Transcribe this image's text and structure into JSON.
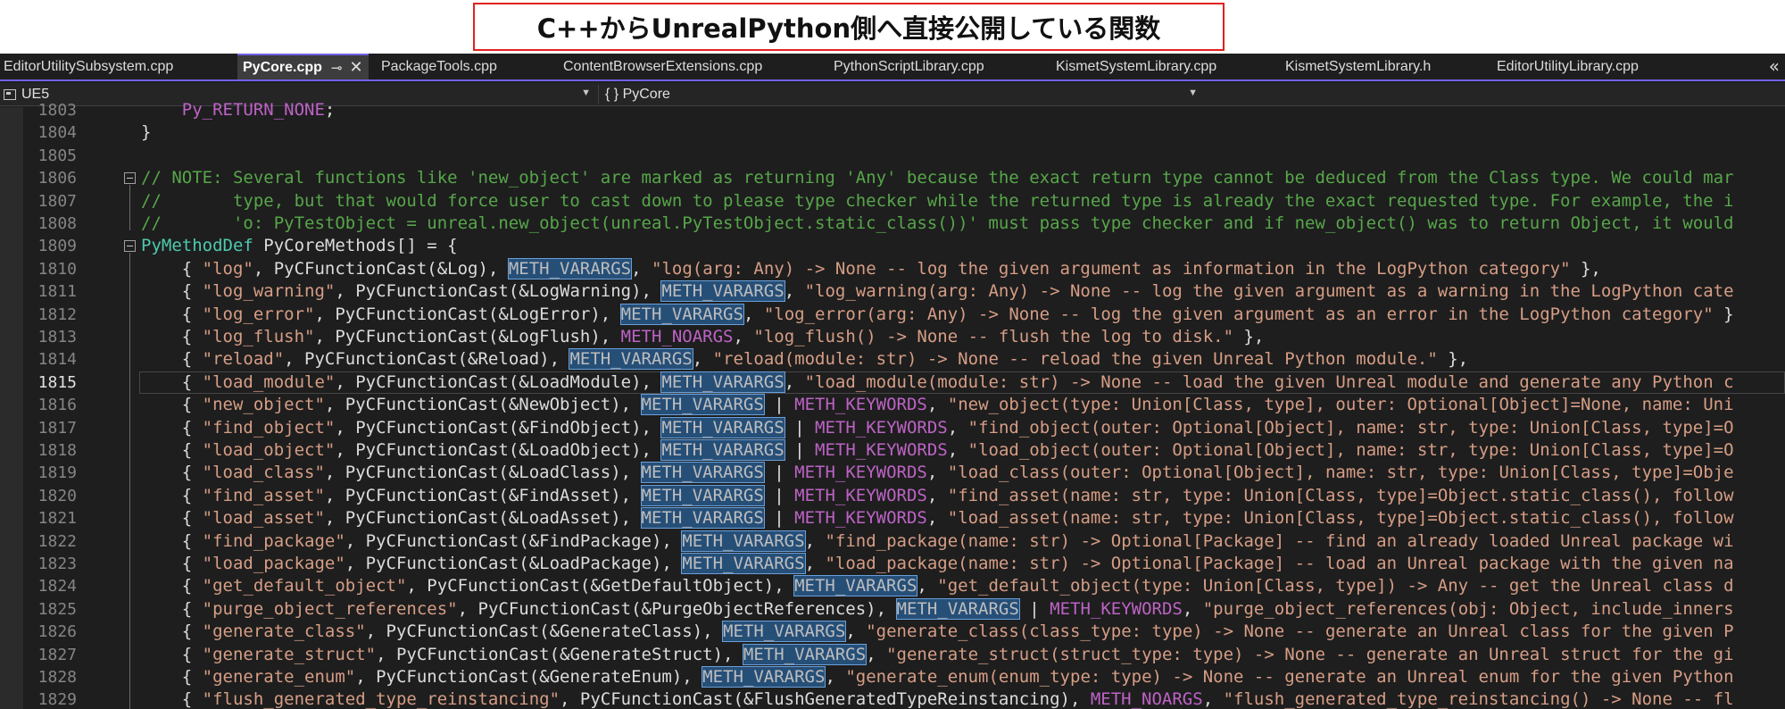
{
  "banner": {
    "title": "C++からUnrealPython側へ直接公開している関数"
  },
  "tabs": [
    {
      "label": "EditorUtilitySubsystem.cpp",
      "active": false
    },
    {
      "label": "PyCore.cpp",
      "active": true
    },
    {
      "label": "PackageTools.cpp",
      "active": false
    },
    {
      "label": "ContentBrowserExtensions.cpp",
      "active": false
    },
    {
      "label": "PythonScriptLibrary.cpp",
      "active": false
    },
    {
      "label": "KismetSystemLibrary.cpp",
      "active": false
    },
    {
      "label": "KismetSystemLibrary.h",
      "active": false
    },
    {
      "label": "EditorUtilityLibrary.cpp",
      "active": false
    }
  ],
  "tab_icons": {
    "pin": "pin-icon",
    "close": "close-icon",
    "overflow": "chevron-double-left-icon"
  },
  "navbar": {
    "project": "UE5",
    "scope": "{ } PyCore"
  },
  "current_line": "1815",
  "lines": [
    {
      "n": "1803",
      "code": "    Py_RETURN_NONE;"
    },
    {
      "n": "1804",
      "code": "}"
    },
    {
      "n": "1805",
      "code": ""
    },
    {
      "n": "1806",
      "code": "// NOTE: Several functions like 'new_object' are marked as returning 'Any' because the exact return type cannot be deduced from the Class type. We could mar"
    },
    {
      "n": "1807",
      "code": "//       type, but that would force user to cast down to please type checker while the returned type is already the exact requested type. For example, the i"
    },
    {
      "n": "1808",
      "code": "//       'o: PyTestObject = unreal.new_object(unreal.PyTestObject.static_class())' must pass type checker and if new_object() was to return Object, it would"
    },
    {
      "n": "1809",
      "code": "PyMethodDef PyCoreMethods[] = {"
    },
    {
      "n": "1810",
      "code": "    { \"log\", PyCFunctionCast(&Log), METH_VARARGS, \"log(arg: Any) -> None -- log the given argument as information in the LogPython category\" },"
    },
    {
      "n": "1811",
      "code": "    { \"log_warning\", PyCFunctionCast(&LogWarning), METH_VARARGS, \"log_warning(arg: Any) -> None -- log the given argument as a warning in the LogPython cate"
    },
    {
      "n": "1812",
      "code": "    { \"log_error\", PyCFunctionCast(&LogError), METH_VARARGS, \"log_error(arg: Any) -> None -- log the given argument as an error in the LogPython category\" }"
    },
    {
      "n": "1813",
      "code": "    { \"log_flush\", PyCFunctionCast(&LogFlush), METH_NOARGS, \"log_flush() -> None -- flush the log to disk.\" },"
    },
    {
      "n": "1814",
      "code": "    { \"reload\", PyCFunctionCast(&Reload), METH_VARARGS, \"reload(module: str) -> None -- reload the given Unreal Python module.\" },"
    },
    {
      "n": "1815",
      "code": "    { \"load_module\", PyCFunctionCast(&LoadModule), METH_VARARGS, \"load_module(module: str) -> None -- load the given Unreal module and generate any Python c"
    },
    {
      "n": "1816",
      "code": "    { \"new_object\", PyCFunctionCast(&NewObject), METH_VARARGS | METH_KEYWORDS, \"new_object(type: Union[Class, type], outer: Optional[Object]=None, name: Uni"
    },
    {
      "n": "1817",
      "code": "    { \"find_object\", PyCFunctionCast(&FindObject), METH_VARARGS | METH_KEYWORDS, \"find_object(outer: Optional[Object], name: str, type: Union[Class, type]=O"
    },
    {
      "n": "1818",
      "code": "    { \"load_object\", PyCFunctionCast(&LoadObject), METH_VARARGS | METH_KEYWORDS, \"load_object(outer: Optional[Object], name: str, type: Union[Class, type]=O"
    },
    {
      "n": "1819",
      "code": "    { \"load_class\", PyCFunctionCast(&LoadClass), METH_VARARGS | METH_KEYWORDS, \"load_class(outer: Optional[Object], name: str, type: Union[Class, type]=Obje"
    },
    {
      "n": "1820",
      "code": "    { \"find_asset\", PyCFunctionCast(&FindAsset), METH_VARARGS | METH_KEYWORDS, \"find_asset(name: str, type: Union[Class, type]=Object.static_class(), follow"
    },
    {
      "n": "1821",
      "code": "    { \"load_asset\", PyCFunctionCast(&LoadAsset), METH_VARARGS | METH_KEYWORDS, \"load_asset(name: str, type: Union[Class, type]=Object.static_class(), follow"
    },
    {
      "n": "1822",
      "code": "    { \"find_package\", PyCFunctionCast(&FindPackage), METH_VARARGS, \"find_package(name: str) -> Optional[Package] -- find an already loaded Unreal package wi"
    },
    {
      "n": "1823",
      "code": "    { \"load_package\", PyCFunctionCast(&LoadPackage), METH_VARARGS, \"load_package(name: str) -> Optional[Package] -- load an Unreal package with the given na"
    },
    {
      "n": "1824",
      "code": "    { \"get_default_object\", PyCFunctionCast(&GetDefaultObject), METH_VARARGS, \"get_default_object(type: Union[Class, type]) -> Any -- get the Unreal class d"
    },
    {
      "n": "1825",
      "code": "    { \"purge_object_references\", PyCFunctionCast(&PurgeObjectReferences), METH_VARARGS | METH_KEYWORDS, \"purge_object_references(obj: Object, include_inners"
    },
    {
      "n": "1826",
      "code": "    { \"generate_class\", PyCFunctionCast(&GenerateClass), METH_VARARGS, \"generate_class(class_type: type) -> None -- generate an Unreal class for the given P"
    },
    {
      "n": "1827",
      "code": "    { \"generate_struct\", PyCFunctionCast(&GenerateStruct), METH_VARARGS, \"generate_struct(struct_type: type) -> None -- generate an Unreal struct for the gi"
    },
    {
      "n": "1828",
      "code": "    { \"generate_enum\", PyCFunctionCast(&GenerateEnum), METH_VARARGS, \"generate_enum(enum_type: type) -> None -- generate an Unreal enum for the given Python"
    },
    {
      "n": "1829",
      "code": "    { \"flush_generated_type_reinstancing\", PyCFunctionCast(&FlushGeneratedTypeReinstancing), METH_NOARGS, \"flush_generated_type_reinstancing() -> None -- fl"
    }
  ],
  "colors": {
    "keyword": "#569cd6",
    "string": "#d69d85",
    "comment": "#57a64a",
    "type": "#4ec9b0",
    "macro": "#bd63c5",
    "highlight": "#264f78",
    "accent": "#7160e8",
    "banner_border": "#e02020"
  }
}
